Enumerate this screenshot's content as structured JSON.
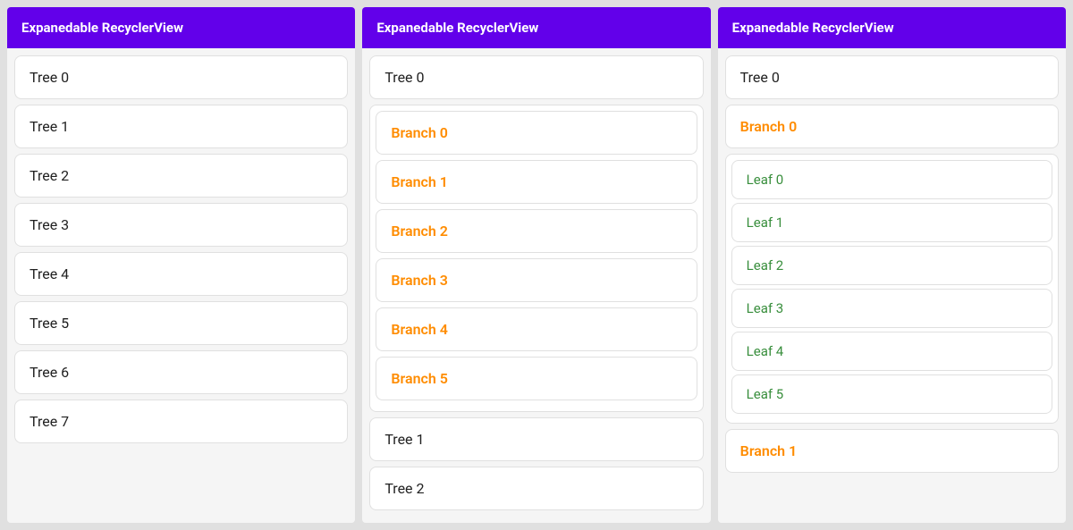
{
  "panels": [
    {
      "id": "panel-1",
      "header": "Expanedable RecyclerView",
      "trees": [
        {
          "label": "Tree 0"
        },
        {
          "label": "Tree 1"
        },
        {
          "label": "Tree 2"
        },
        {
          "label": "Tree 3"
        },
        {
          "label": "Tree 4"
        },
        {
          "label": "Tree 5"
        },
        {
          "label": "Tree 6"
        },
        {
          "label": "Tree 7"
        }
      ]
    },
    {
      "id": "panel-2",
      "header": "Expanedable RecyclerView",
      "items": [
        {
          "type": "tree",
          "label": "Tree 0",
          "expanded": true,
          "branches": [
            {
              "label": "Branch 0"
            },
            {
              "label": "Branch 1"
            },
            {
              "label": "Branch 2"
            },
            {
              "label": "Branch 3"
            },
            {
              "label": "Branch 4"
            },
            {
              "label": "Branch 5"
            }
          ]
        },
        {
          "type": "tree",
          "label": "Tree 1",
          "expanded": false
        },
        {
          "type": "tree",
          "label": "Tree 2",
          "expanded": false
        }
      ]
    },
    {
      "id": "panel-3",
      "header": "Expanedable RecyclerView",
      "items": [
        {
          "type": "tree",
          "label": "Tree 0",
          "expanded": true,
          "branches": [
            {
              "label": "Branch 0",
              "expanded": true,
              "leaves": [
                {
                  "label": "Leaf 0"
                },
                {
                  "label": "Leaf 1"
                },
                {
                  "label": "Leaf 2"
                },
                {
                  "label": "Leaf 3"
                },
                {
                  "label": "Leaf 4"
                },
                {
                  "label": "Leaf 5"
                }
              ]
            },
            {
              "label": "Branch 1",
              "expanded": false
            }
          ]
        }
      ]
    }
  ]
}
